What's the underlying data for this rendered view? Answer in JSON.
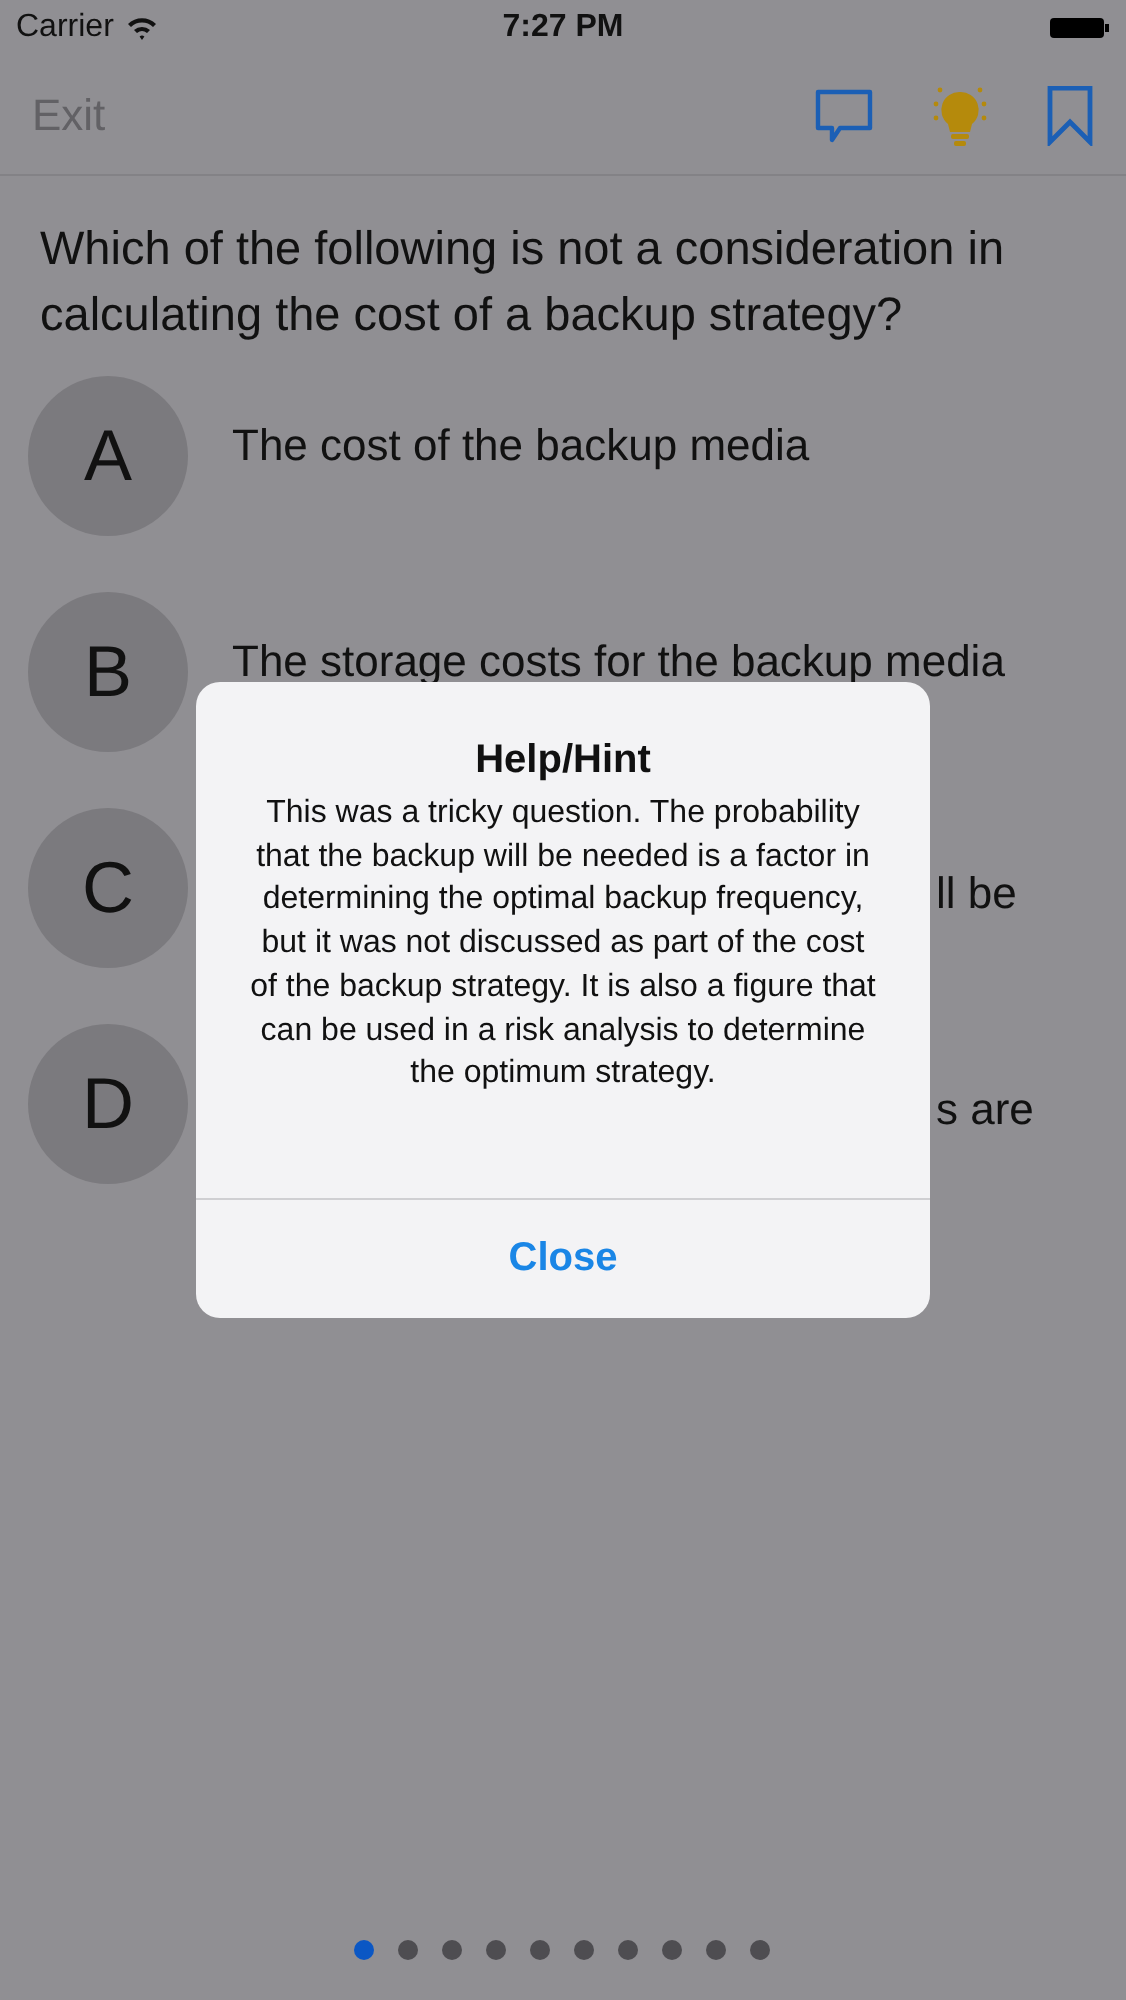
{
  "status_bar": {
    "carrier": "Carrier",
    "time": "7:27 PM"
  },
  "nav_bar": {
    "exit": "Exit"
  },
  "question": "Which of the following is not a consideration in calculating the cost of a backup strategy?",
  "options": [
    {
      "letter": "A",
      "text": "The cost of the backup media",
      "kind": "full"
    },
    {
      "letter": "B",
      "text": "The storage costs for the backup media",
      "kind": "full"
    },
    {
      "letter": "C",
      "text": "ll be",
      "kind": "cut"
    },
    {
      "letter": "D",
      "text": "s are",
      "kind": "cut"
    }
  ],
  "dialog": {
    "title": "Help/Hint",
    "message": "This was a tricky question. The probability that the backup will be needed is a factor in determining the optimal backup frequency, but it was not discussed as part of the cost of the backup strategy. It is also a figure that can be used in a risk analysis to determine the optimum strategy.",
    "button": "Close"
  },
  "pages": [
    {
      "selected": true
    },
    {
      "selected": false
    },
    {
      "selected": false
    },
    {
      "selected": false
    },
    {
      "selected": false
    },
    {
      "selected": false
    },
    {
      "selected": false
    },
    {
      "selected": false
    },
    {
      "selected": false
    },
    {
      "selected": false
    }
  ]
}
